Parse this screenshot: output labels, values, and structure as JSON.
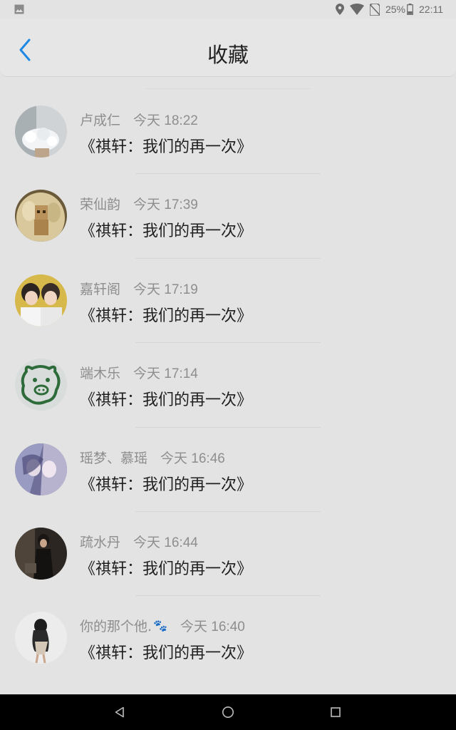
{
  "status_bar": {
    "battery": "25%",
    "time": "22:11"
  },
  "header": {
    "title": "收藏",
    "back_icon": "chevron-left-icon",
    "accent": "#1e88e5"
  },
  "favorites": [
    {
      "name": "卢成仁",
      "time": "今天 18:22",
      "content": "《祺轩：我们的再一次》",
      "avatar_icon": "flower-photo"
    },
    {
      "name": "荣仙韵",
      "time": "今天 17:39",
      "content": "《祺轩：我们的再一次》",
      "avatar_icon": "danbo-photo"
    },
    {
      "name": "嘉轩阁",
      "time": "今天 17:19",
      "content": "《祺轩：我们的再一次》",
      "avatar_icon": "two-people-photo"
    },
    {
      "name": "端木乐",
      "time": "今天 17:14",
      "content": "《祺轩：我们的再一次》",
      "avatar_icon": "pig-drawing"
    },
    {
      "name": "瑶梦、慕瑶",
      "time": "今天 16:46",
      "content": "《祺轩：我们的再一次》",
      "avatar_icon": "anime-art"
    },
    {
      "name": "疏水丹",
      "time": "今天 16:44",
      "content": "《祺轩：我们的再一次》",
      "avatar_icon": "dark-portrait"
    },
    {
      "name": "你的那个他.",
      "name_suffix": "🐾",
      "time": "今天 16:40",
      "content": "《祺轩：我们的再一次》",
      "avatar_icon": "girl-walking-photo"
    }
  ]
}
